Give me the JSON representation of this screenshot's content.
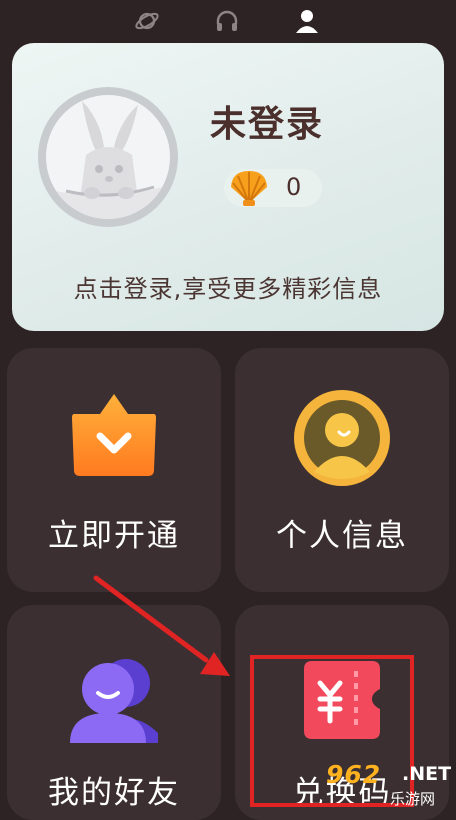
{
  "top_nav": {
    "tabs": [
      {
        "icon": "planet-icon",
        "active": false
      },
      {
        "icon": "headphones-icon",
        "active": false
      },
      {
        "icon": "person-icon",
        "active": true
      }
    ]
  },
  "profile": {
    "username": "未登录",
    "coins": "0",
    "login_tip": "点击登录,享受更多精彩信息"
  },
  "tiles": [
    {
      "label": "立即开通",
      "icon": "vip-crown-icon"
    },
    {
      "label": "个人信息",
      "icon": "profile-info-icon"
    },
    {
      "label": "我的好友",
      "icon": "friends-icon"
    },
    {
      "label": "兑换码",
      "icon": "ticket-icon"
    }
  ],
  "watermark": {
    "number": "962",
    "tld": ".NET",
    "site": "乐游网"
  },
  "colors": {
    "background": "#2e2324",
    "tile": "#3b2f31",
    "annotation": "#e02424",
    "title_text": "#4b2f2c"
  }
}
